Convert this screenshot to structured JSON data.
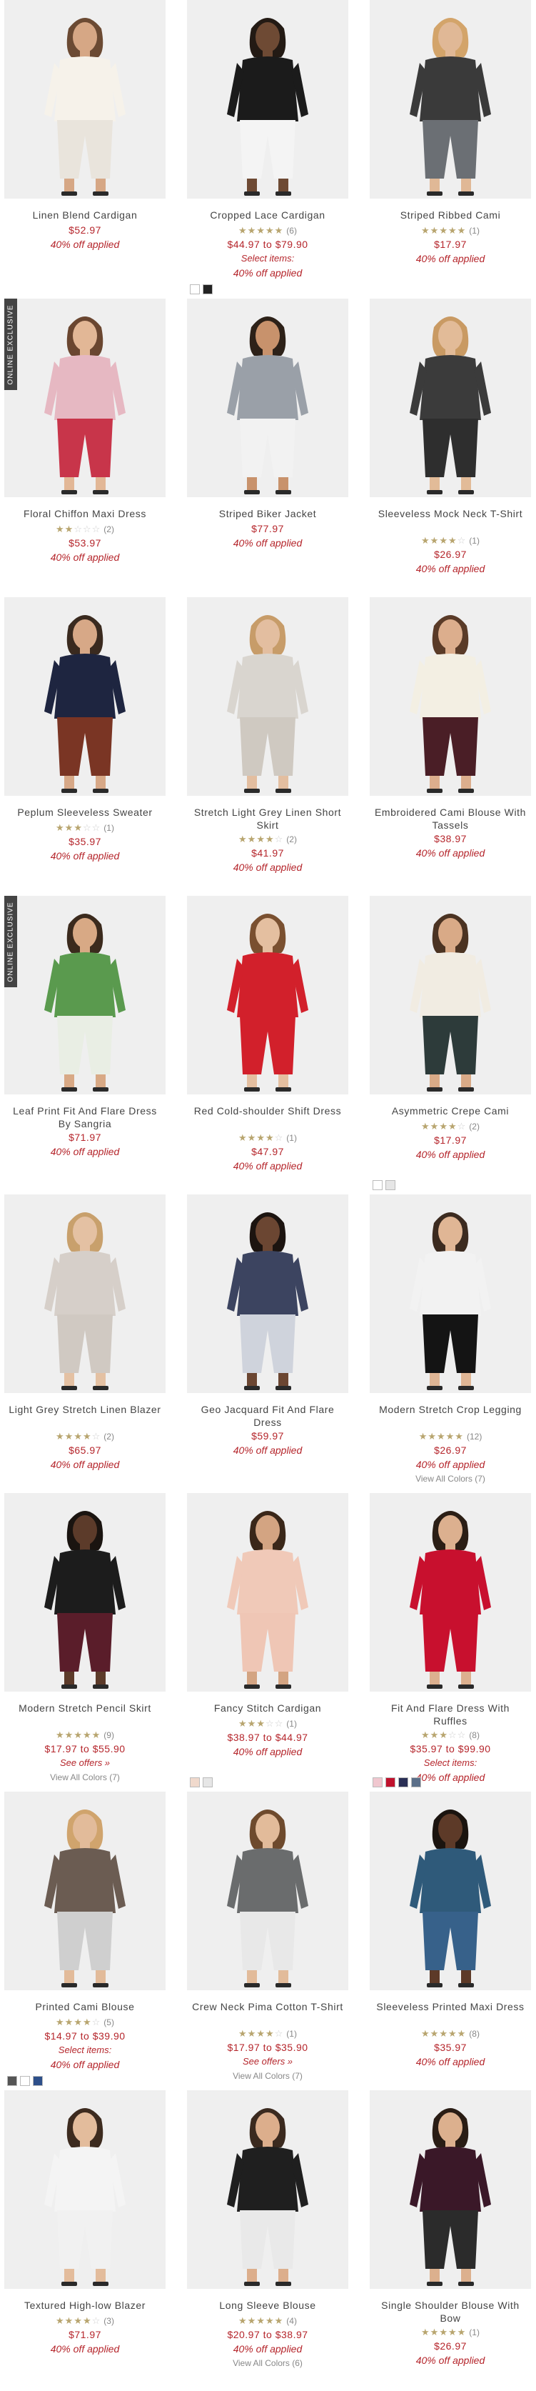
{
  "colors": {
    "price": "#b5252b",
    "star": "#b8a56f",
    "badge_bg": "#444444"
  },
  "products": [
    {
      "name": "Linen Blend Cardigan",
      "price": "$52.97",
      "promo": "40% off applied",
      "rating": null,
      "count": null,
      "offer": null,
      "view_all": null,
      "badge": null,
      "swatches": [],
      "art": {
        "bg": "#efefef",
        "top": "#f6f2ea",
        "bottom": "#e9e4dc",
        "skin": "#d6a785",
        "hair": "#6b4a33"
      }
    },
    {
      "name": "Cropped Lace Cardigan",
      "price": "$44.97 to $79.90",
      "promo": "40% off applied",
      "rating": 5,
      "count": "(6)",
      "offer": "Select items:",
      "view_all": null,
      "badge": null,
      "swatches": [
        "#ffffff",
        "#222222"
      ],
      "art": {
        "bg": "#efefef",
        "top": "#1b1b1b",
        "bottom": "#f4f4f4",
        "skin": "#6e4a34",
        "hair": "#231a14"
      }
    },
    {
      "name": "Striped Ribbed Cami",
      "price": "$17.97",
      "promo": "40% off applied",
      "rating": 5,
      "count": "(1)",
      "offer": null,
      "view_all": null,
      "badge": null,
      "swatches": [],
      "art": {
        "bg": "#efefef",
        "top": "#3a3a3a",
        "bottom": "#6b6f74",
        "skin": "#e0b896",
        "hair": "#d3a46a"
      }
    },
    {
      "name": "Floral Chiffon Maxi Dress",
      "price": "$53.97",
      "promo": "40% off applied",
      "rating": 2,
      "count": "(2)",
      "offer": null,
      "view_all": null,
      "badge": "ONLINE EXCLUSIVE",
      "swatches": [],
      "art": {
        "bg": "#efefef",
        "top": "#e6b8c2",
        "bottom": "#c8354a",
        "skin": "#e2b796",
        "hair": "#6a4630"
      }
    },
    {
      "name": "Striped Biker Jacket",
      "price": "$77.97",
      "promo": "40% off applied",
      "rating": null,
      "count": null,
      "offer": null,
      "view_all": null,
      "badge": null,
      "swatches": [],
      "art": {
        "bg": "#efefef",
        "top": "#9aa0a8",
        "bottom": "#f2f2f2",
        "skin": "#c8926c",
        "hair": "#2d2118"
      }
    },
    {
      "name": "Sleeveless Mock Neck T-Shirt",
      "price": "$26.97",
      "promo": "40% off applied",
      "rating": 4,
      "count": "(1)",
      "offer": null,
      "view_all": null,
      "badge": null,
      "swatches": [],
      "art": {
        "bg": "#efefef",
        "top": "#3b3b3b",
        "bottom": "#2e2e2e",
        "skin": "#e2bb98",
        "hair": "#c99a63"
      }
    },
    {
      "name": "Peplum Sleeveless Sweater",
      "price": "$35.97",
      "promo": "40% off applied",
      "rating": 3,
      "count": "(1)",
      "offer": null,
      "view_all": null,
      "badge": null,
      "swatches": [],
      "art": {
        "bg": "#efefef",
        "top": "#1e2540",
        "bottom": "#7a3524",
        "skin": "#d7a887",
        "hair": "#3a2a1f"
      }
    },
    {
      "name": "Stretch Light Grey Linen Short Skirt",
      "price": "$41.97",
      "promo": "40% off applied",
      "rating": 4,
      "count": "(2)",
      "offer": null,
      "view_all": null,
      "badge": null,
      "swatches": [],
      "art": {
        "bg": "#efefef",
        "top": "#d9d5cf",
        "bottom": "#cfc9c1",
        "skin": "#e3bea0",
        "hair": "#c79c69"
      }
    },
    {
      "name": "Embroidered Cami Blouse With Tassels",
      "price": "$38.97",
      "promo": "40% off applied",
      "rating": null,
      "count": null,
      "offer": null,
      "view_all": null,
      "badge": null,
      "swatches": [],
      "art": {
        "bg": "#efefef",
        "top": "#f3efe3",
        "bottom": "#4a1e26",
        "skin": "#dcae8d",
        "hair": "#5a3b28"
      }
    },
    {
      "name": "Leaf Print Fit And Flare Dress By Sangria",
      "price": "$71.97",
      "promo": "40% off applied",
      "rating": null,
      "count": null,
      "offer": null,
      "view_all": null,
      "badge": "ONLINE EXCLUSIVE",
      "swatches": [],
      "art": {
        "bg": "#efefef",
        "top": "#5a9a4e",
        "bottom": "#e9eee4",
        "skin": "#d8a985",
        "hair": "#3b2a1d"
      }
    },
    {
      "name": "Red Cold-shoulder Shift Dress",
      "price": "$47.97",
      "promo": "40% off applied",
      "rating": 4,
      "count": "(1)",
      "offer": null,
      "view_all": null,
      "badge": null,
      "swatches": [],
      "art": {
        "bg": "#efefef",
        "top": "#d2202b",
        "bottom": "#d2202b",
        "skin": "#e4bfa0",
        "hair": "#7a5030"
      }
    },
    {
      "name": "Asymmetric Crepe Cami",
      "price": "$17.97",
      "promo": "40% off applied",
      "rating": 4,
      "count": "(2)",
      "offer": null,
      "view_all": null,
      "badge": null,
      "swatches": [
        "#ffffff",
        "#e6e6e6"
      ],
      "art": {
        "bg": "#efefef",
        "top": "#f1ece2",
        "bottom": "#2d3b3a",
        "skin": "#d9aa87",
        "hair": "#4b3322"
      }
    },
    {
      "name": "Light Grey Stretch Linen Blazer",
      "price": "$65.97",
      "promo": "40% off applied",
      "rating": 4,
      "count": "(2)",
      "offer": null,
      "view_all": null,
      "badge": null,
      "swatches": [],
      "art": {
        "bg": "#efefef",
        "top": "#d6cfc9",
        "bottom": "#d0c9c2",
        "skin": "#e4c1a3",
        "hair": "#c8a06c"
      }
    },
    {
      "name": "Geo Jacquard Fit And Flare Dress",
      "price": "$59.97",
      "promo": "40% off applied",
      "rating": null,
      "count": null,
      "offer": null,
      "view_all": null,
      "badge": null,
      "swatches": [],
      "art": {
        "bg": "#efefef",
        "top": "#3c4460",
        "bottom": "#cfd3dc",
        "skin": "#6b4632",
        "hair": "#1c1410"
      }
    },
    {
      "name": "Modern Stretch Crop Legging",
      "price": "$26.97",
      "promo": "40% off applied",
      "rating": 5,
      "count": "(12)",
      "offer": null,
      "view_all": "View All Colors (7)",
      "badge": null,
      "swatches": [],
      "art": {
        "bg": "#efefef",
        "top": "#f2f2f2",
        "bottom": "#141414",
        "skin": "#e0b695",
        "hair": "#3c2b20"
      }
    },
    {
      "name": "Modern Stretch Pencil Skirt",
      "price": "$17.97 to $55.90",
      "promo": null,
      "rating": 5,
      "count": "(9)",
      "offer": "See offers »",
      "view_all": "View All Colors (7)",
      "badge": null,
      "swatches": [],
      "art": {
        "bg": "#efefef",
        "top": "#1c1c1c",
        "bottom": "#5a1d2a",
        "skin": "#5c3b2a",
        "hair": "#1a1410"
      }
    },
    {
      "name": "Fancy Stitch Cardigan",
      "price": "$38.97 to $44.97",
      "promo": "40% off applied",
      "rating": 3,
      "count": "(1)",
      "offer": null,
      "view_all": null,
      "badge": null,
      "swatches": [
        "#f0d9cc",
        "#e6e6e6"
      ],
      "art": {
        "bg": "#efefef",
        "top": "#f0c9b8",
        "bottom": "#efc6b5",
        "skin": "#d3a482",
        "hair": "#3a2719"
      }
    },
    {
      "name": "Fit And Flare Dress With Ruffles",
      "price": "$35.97 to $99.90",
      "promo": "40% off applied",
      "rating": 3,
      "count": "(8)",
      "offer": "Select items:",
      "view_all": null,
      "badge": null,
      "swatches": [
        "#f0c7cf",
        "#c0122d",
        "#2a2f55",
        "#5b6f89"
      ],
      "art": {
        "bg": "#efefef",
        "top": "#c8102e",
        "bottom": "#c8102e",
        "skin": "#dcb08f",
        "hair": "#2b1e15"
      }
    },
    {
      "name": "Printed Cami Blouse",
      "price": "$14.97 to $39.90",
      "promo": "40% off applied",
      "rating": 4,
      "count": "(5)",
      "offer": "Select items:",
      "view_all": null,
      "badge": null,
      "swatches": [
        "#555555",
        "#ffffff",
        "#2d4f8a"
      ],
      "art": {
        "bg": "#efefef",
        "top": "#6b5c52",
        "bottom": "#cfcfcf",
        "skin": "#e2bb9a",
        "hair": "#d0a46d"
      }
    },
    {
      "name": "Crew Neck Pima Cotton T-Shirt",
      "price": "$17.97 to $35.90",
      "promo": null,
      "rating": 4,
      "count": "(1)",
      "offer": "See offers »",
      "view_all": "View All Colors (7)",
      "badge": null,
      "swatches": [],
      "art": {
        "bg": "#efefef",
        "top": "#6a6c6d",
        "bottom": "#e8e8e8",
        "skin": "#e2bb9a",
        "hair": "#6e4a2d"
      }
    },
    {
      "name": "Sleeveless Printed Maxi Dress",
      "price": "$35.97",
      "promo": "40% off applied",
      "rating": 5,
      "count": "(8)",
      "offer": null,
      "view_all": null,
      "badge": null,
      "swatches": [],
      "art": {
        "bg": "#efefef",
        "top": "#2f5a7a",
        "bottom": "#37618a",
        "skin": "#5d3a28",
        "hair": "#1b140f"
      }
    },
    {
      "name": "Textured High-low Blazer",
      "price": "$71.97",
      "promo": "40% off applied",
      "rating": 4,
      "count": "(3)",
      "offer": null,
      "view_all": null,
      "badge": null,
      "swatches": [],
      "art": {
        "bg": "#efefef",
        "top": "#f4f4f4",
        "bottom": "#f1f1f1",
        "skin": "#e3bc9c",
        "hair": "#3d2b1f"
      }
    },
    {
      "name": "Long Sleeve Blouse",
      "price": "$20.97 to $38.97",
      "promo": "40% off applied",
      "rating": 5,
      "count": "(4)",
      "offer": null,
      "view_all": "View All Colors (6)",
      "badge": null,
      "swatches": [],
      "art": {
        "bg": "#efefef",
        "top": "#1f1f1f",
        "bottom": "#e9e9e9",
        "skin": "#dcae8c",
        "hair": "#3b2a1f"
      }
    },
    {
      "name": "Single Shoulder Blouse With Bow",
      "price": "$26.97",
      "promo": "40% off applied",
      "rating": 5,
      "count": "(1)",
      "offer": null,
      "view_all": null,
      "badge": null,
      "swatches": [],
      "art": {
        "bg": "#efefef",
        "top": "#3a1828",
        "bottom": "#2b2b2b",
        "skin": "#dcb08e",
        "hair": "#2a1d15"
      }
    }
  ]
}
